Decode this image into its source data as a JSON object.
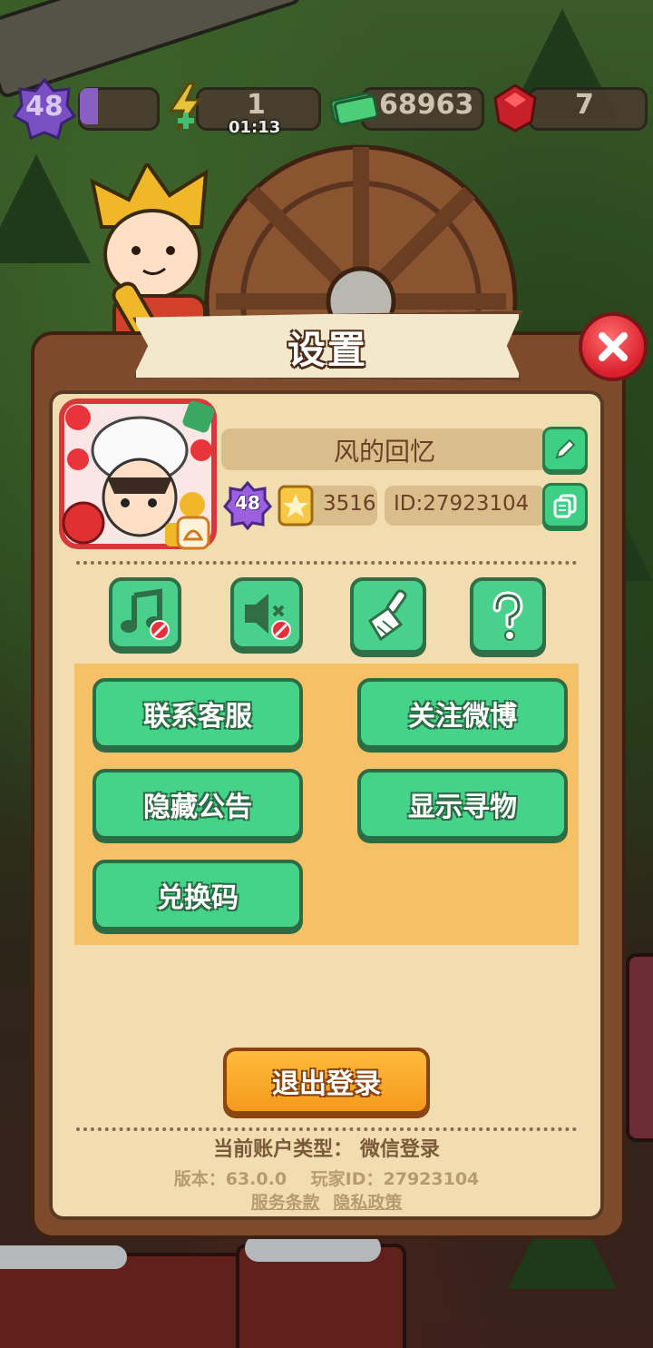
{
  "hud": {
    "level": "48",
    "energy": "1",
    "energy_timer": "01:13",
    "cash": "68963",
    "gems": "7"
  },
  "settings": {
    "title": "设置",
    "profile": {
      "name": "风的回忆",
      "level": "48",
      "cards": "3516",
      "id": "ID:27923104"
    },
    "toggles": [
      {
        "icon": "music-off-icon"
      },
      {
        "icon": "sound-off-icon"
      },
      {
        "icon": "broom-icon"
      },
      {
        "icon": "question-icon"
      }
    ],
    "buttons": {
      "contact_support": "联系客服",
      "follow_weibo": "关注微博",
      "hide_announcement": "隐藏公告",
      "show_finder": "显示寻物",
      "redeem_code": "兑换码"
    },
    "logout": "退出登录",
    "account_type": "当前账户类型： 微信登录",
    "version": "版本：63.0.0",
    "player_id": "玩家ID：27923104",
    "terms": "服务条款",
    "privacy": "隐私政策"
  },
  "colors": {
    "green_button": "#45d38a",
    "orange_button": "#f49a1c",
    "panel_brown": "#7d4b2c",
    "parchment": "#f1ddb0",
    "close_red": "#d9202c"
  }
}
